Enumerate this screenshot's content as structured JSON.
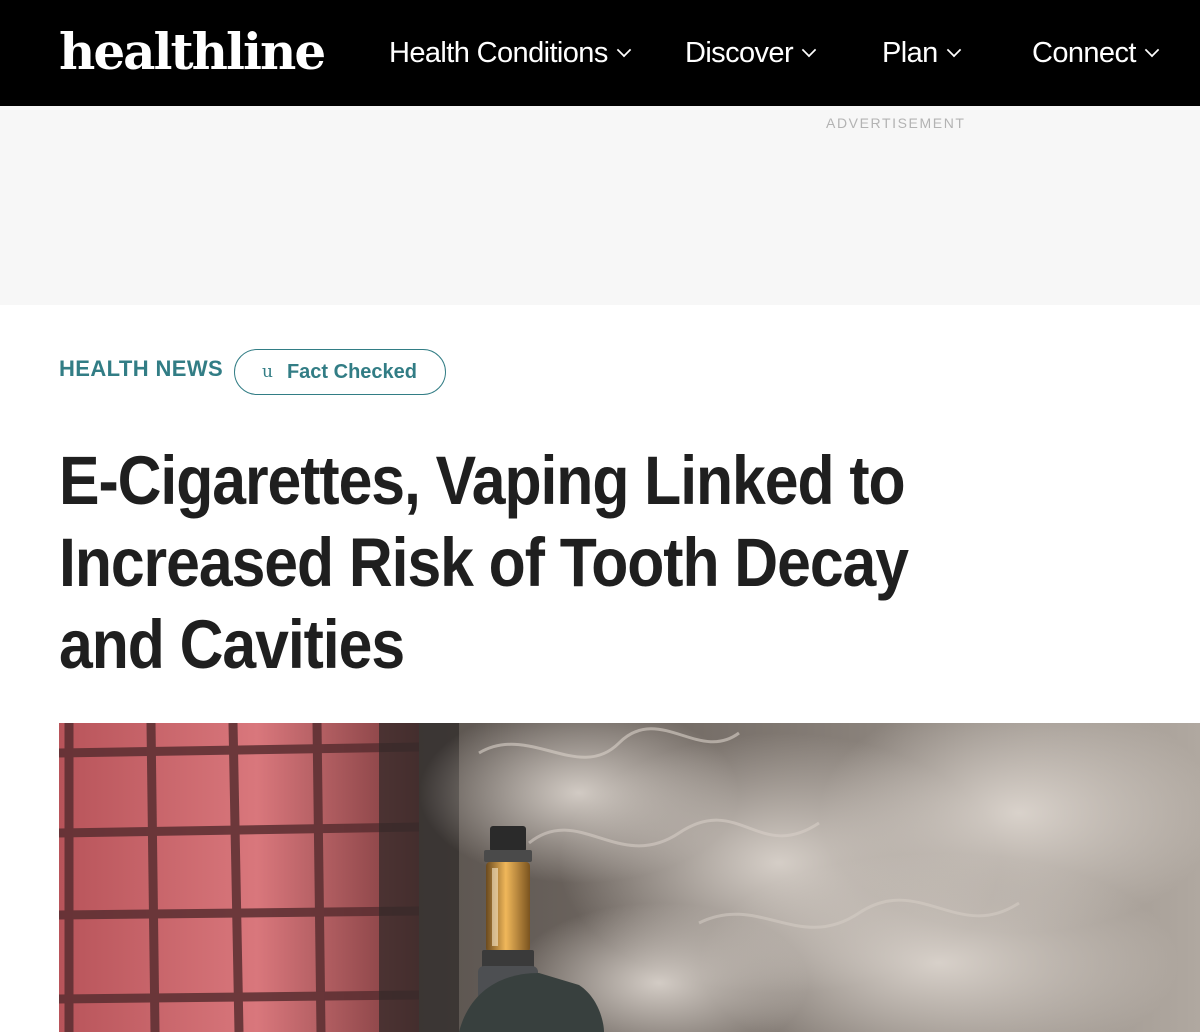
{
  "header": {
    "logo_text": "healthline",
    "nav": [
      {
        "label": "Health Conditions"
      },
      {
        "label": "Discover"
      },
      {
        "label": "Plan"
      },
      {
        "label": "Connect"
      }
    ]
  },
  "ad": {
    "label": "ADVERTISEMENT"
  },
  "article": {
    "section": "HEALTH NEWS",
    "fact_badge": {
      "glyph": "u",
      "label": "Fact Checked"
    },
    "headline": "E-Cigarettes, Vaping Linked to Increased Risk of Tooth Decay and Cavities",
    "hero_image": {
      "subject": "e-cigarette vape device with smoke against a red tiled wall"
    }
  },
  "colors": {
    "nav_background": "#000000",
    "accent_teal": "#327d85",
    "headline_text": "#1f1f1f",
    "ad_background": "#f7f7f7"
  },
  "icons": {
    "nav_chevron": "chevron-down-icon",
    "fact_check": "check-icon"
  }
}
